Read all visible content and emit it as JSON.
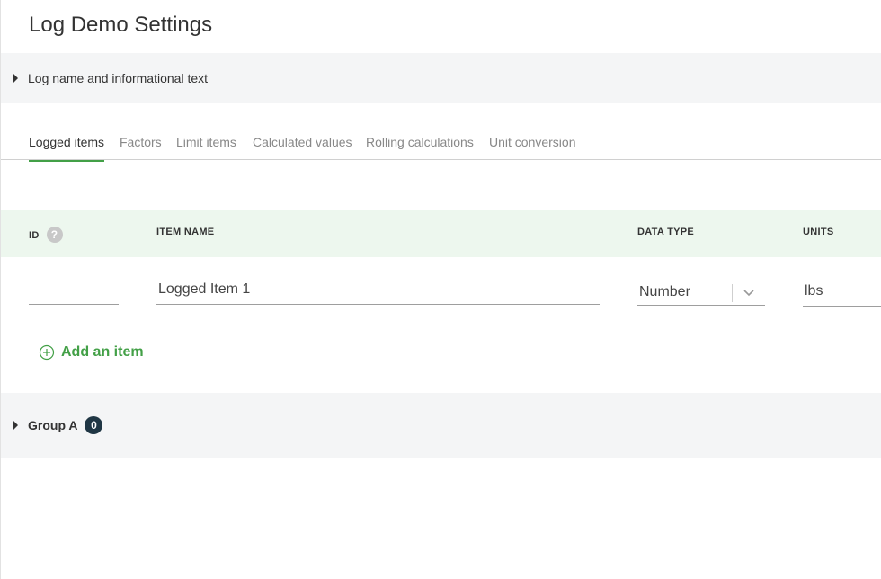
{
  "page": {
    "title": "Log Demo Settings"
  },
  "info_section": {
    "label": "Log name and informational text"
  },
  "tabs": [
    {
      "label": "Logged items",
      "active": true
    },
    {
      "label": "Factors"
    },
    {
      "label": "Limit items"
    },
    {
      "label": "Calculated values"
    },
    {
      "label": "Rolling calculations"
    },
    {
      "label": "Unit conversion"
    }
  ],
  "table": {
    "headers": {
      "id": "ID",
      "item_name": "ITEM NAME",
      "data_type": "DATA TYPE",
      "units": "UNITS"
    },
    "help_icon": "?",
    "rows": [
      {
        "id": "",
        "item_name": "Logged Item 1",
        "data_type": "Number",
        "units": "lbs"
      }
    ]
  },
  "add_item": {
    "label": "Add an item",
    "icon": "plus-circle-icon"
  },
  "group": {
    "label": "Group A",
    "count": "0"
  },
  "colors": {
    "accent": "#43a047",
    "badge": "#1f3644",
    "header_bg": "#edf7ee",
    "section_bg": "#f4f5f6"
  }
}
